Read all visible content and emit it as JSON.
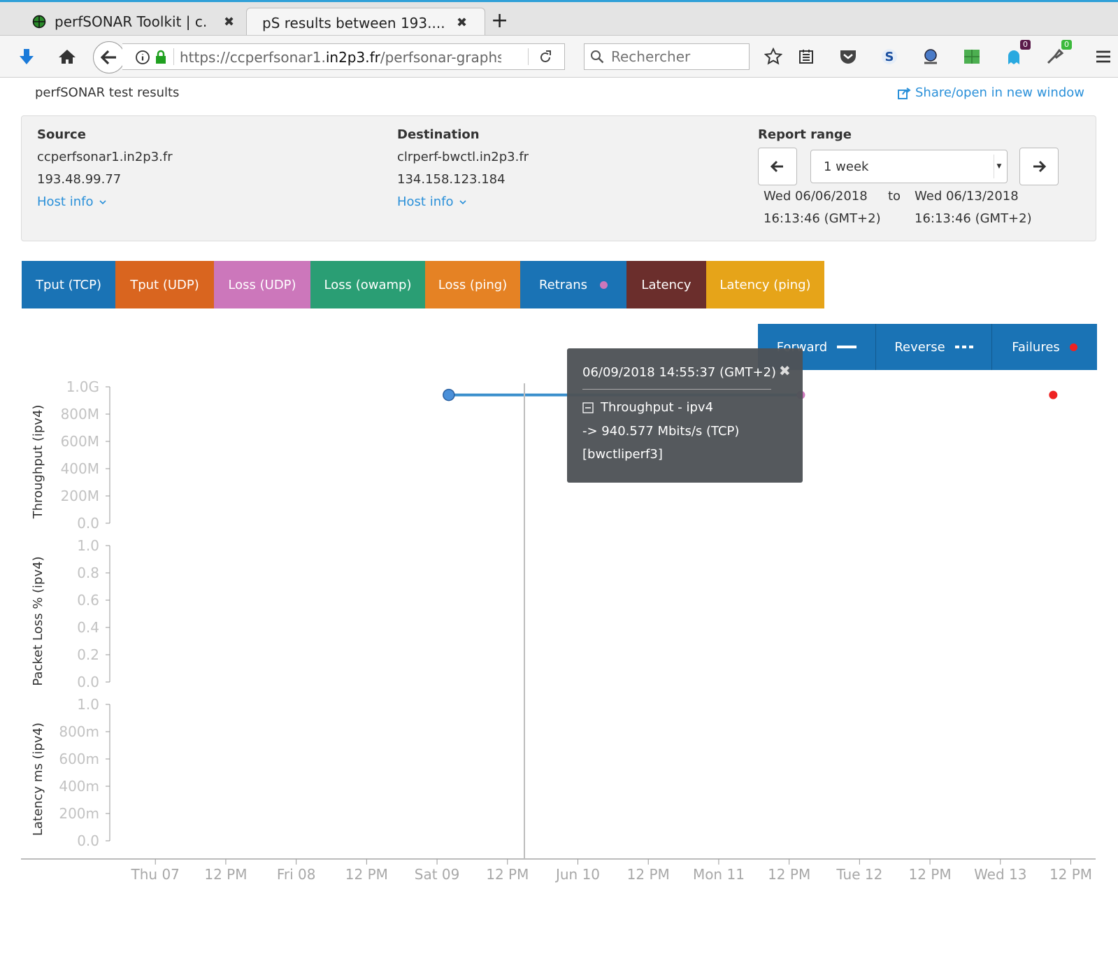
{
  "browser": {
    "tabs": [
      {
        "title": "perfSONAR Toolkit | c...",
        "active": false
      },
      {
        "title": "pS results between 193....",
        "active": true
      }
    ],
    "url": {
      "prefix": "https://ccperfsonar1.",
      "host": "in2p3.fr",
      "path": "/perfsonar-graphs/?"
    },
    "search_placeholder": "Rechercher",
    "badges": {
      "notify_count": "0",
      "addon_count": "0"
    }
  },
  "page": {
    "title": "perfSONAR test results",
    "share_label": "Share/open in new window"
  },
  "source": {
    "label": "Source",
    "host": "ccperfsonar1.in2p3.fr",
    "ip": "193.48.99.77",
    "host_info": "Host info"
  },
  "destination": {
    "label": "Destination",
    "host": "clrperf-bwctl.in2p3.fr",
    "ip": "134.158.123.184",
    "host_info": "Host info"
  },
  "report_range": {
    "label": "Report range",
    "selected": "1 week",
    "start_date": "Wed 06/06/2018",
    "start_time": "16:13:46 (GMT+2)",
    "to": "to",
    "end_date": "Wed 06/13/2018",
    "end_time": "16:13:46 (GMT+2)"
  },
  "test_tabs": [
    {
      "label": "Tput (TCP)",
      "color": "#1a73b5"
    },
    {
      "label": "Tput (UDP)",
      "color": "#d9651f"
    },
    {
      "label": "Loss (UDP)",
      "color": "#cc77bb"
    },
    {
      "label": "Loss (owamp)",
      "color": "#2a9e74"
    },
    {
      "label": "Loss (ping)",
      "color": "#e58224"
    },
    {
      "label": "Retrans",
      "color": "#1a73b5",
      "dot": "#cc77bb"
    },
    {
      "label": "Latency",
      "color": "#6b2e2c"
    },
    {
      "label": "Latency (ping)",
      "color": "#e6a419"
    }
  ],
  "direction_buttons": {
    "forward": "Forward",
    "reverse": "Reverse",
    "failures": "Failures",
    "failure_color": "#ee2222"
  },
  "tooltip": {
    "date": "06/09/2018 14:55:37 (GMT+2)",
    "line1": "Throughput - ipv4",
    "line2": "-> 940.577 Mbits/s (TCP)",
    "line3": "[bwctliperf3]"
  },
  "chart_data": {
    "type": "line",
    "x_ticks": [
      "Thu 07",
      "12 PM",
      "Fri 08",
      "12 PM",
      "Sat 09",
      "12 PM",
      "Jun 10",
      "12 PM",
      "Mon 11",
      "12 PM",
      "Tue 12",
      "12 PM",
      "Wed 13",
      "12 PM"
    ],
    "panels": [
      {
        "ylabel": "Throughput (ipv4)",
        "y_ticks": [
          "1.0G",
          "800M",
          "600M",
          "400M",
          "200M",
          "0.0"
        ],
        "ylim": [
          0,
          1000000000
        ],
        "series": [
          {
            "values": [
              {
                "x": "2018-06-09 02:00",
                "y": 940577000
              },
              {
                "x": "2018-06-11 14:00",
                "y": 940577000
              }
            ],
            "color": "#3a8fcc"
          }
        ],
        "markers": [
          {
            "x": "2018-06-09 02:00",
            "y": 940577000,
            "color": "#4a90d9"
          },
          {
            "x": "2018-06-11 14:00",
            "y": 940577000,
            "color": "#cc77bb"
          },
          {
            "x": "2018-06-13 09:00",
            "y": 940577000,
            "color": "#ee2222"
          }
        ]
      },
      {
        "ylabel": "Packet Loss % (ipv4)",
        "y_ticks": [
          "1.0",
          "0.8",
          "0.6",
          "0.4",
          "0.2",
          "0.0"
        ],
        "ylim": [
          0,
          1
        ],
        "series": []
      },
      {
        "ylabel": "Latency ms (ipv4)",
        "y_ticks": [
          "1.0",
          "800m",
          "600m",
          "400m",
          "200m",
          "0.0"
        ],
        "ylim": [
          0,
          1
        ],
        "series": []
      }
    ]
  }
}
